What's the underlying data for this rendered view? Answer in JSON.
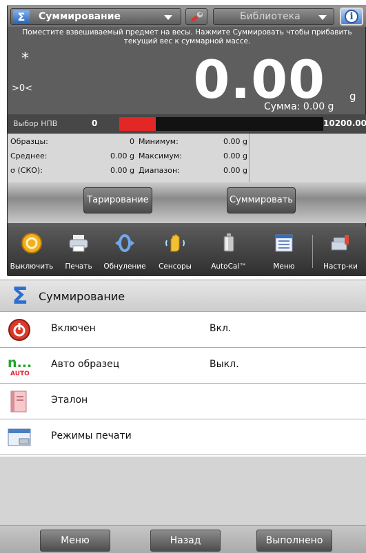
{
  "header": {
    "app_name": "Суммирование",
    "library_label": "Библиотека",
    "instruction": "Поместите взвешиваемый предмет на весы.  Нажмите Суммировать чтобы прибавить текущий вес к суммарной массе."
  },
  "display": {
    "stable_indicator": "*",
    "zero_indicator": ">0<",
    "weight": "0.00",
    "unit": "g",
    "sum_label": "Сумма: 0.00 g"
  },
  "capacity": {
    "label": "Выбор НПВ",
    "min": "0",
    "max": "10200.00",
    "fill_fraction": 0.18
  },
  "stats": {
    "left": [
      {
        "label": "Образцы:",
        "value": "0"
      },
      {
        "label": "Среднее:",
        "value": "0.00 g"
      },
      {
        "label": "σ (СКО):",
        "value": "0.00 g"
      }
    ],
    "right": [
      {
        "label": "Минимум:",
        "value": "0.00 g"
      },
      {
        "label": "Максимум:",
        "value": "0.00 g"
      },
      {
        "label": "Диапазон:",
        "value": "0.00 g"
      }
    ]
  },
  "actions": {
    "tare": "Тарирование",
    "accumulate": "Суммировать"
  },
  "toolbar": [
    {
      "label": "Выключить",
      "icon": "power-icon"
    },
    {
      "label": "Печать",
      "icon": "printer-icon"
    },
    {
      "label": "Обнуление",
      "icon": "zero-icon"
    },
    {
      "label": "Сенсоры",
      "icon": "hand-sensor-icon"
    },
    {
      "label": "AutoCal™",
      "icon": "calibration-weight-icon"
    },
    {
      "label": "Меню",
      "icon": "menu-list-icon"
    },
    {
      "label": "Настр-ки",
      "icon": "settings-scale-icon"
    }
  ],
  "menu": {
    "title": "Суммирование",
    "items": [
      {
        "label": "Включен",
        "value": "Вкл.",
        "icon": "power-on-icon"
      },
      {
        "label": "Авто образец",
        "value": "Выкл.",
        "icon": "auto-sample-icon",
        "icon_text_top": "n...",
        "icon_text_bottom": "AUTO"
      },
      {
        "label": "Эталон",
        "value": "",
        "icon": "reference-book-icon"
      },
      {
        "label": "Режимы печати",
        "value": "",
        "icon": "print-modes-icon"
      }
    ]
  },
  "footer": {
    "menu": "Меню",
    "back": "Назад",
    "done": "Выполнено"
  },
  "colors": {
    "accent_blue": "#2d6fd1",
    "capacity_red": "#e32626"
  }
}
